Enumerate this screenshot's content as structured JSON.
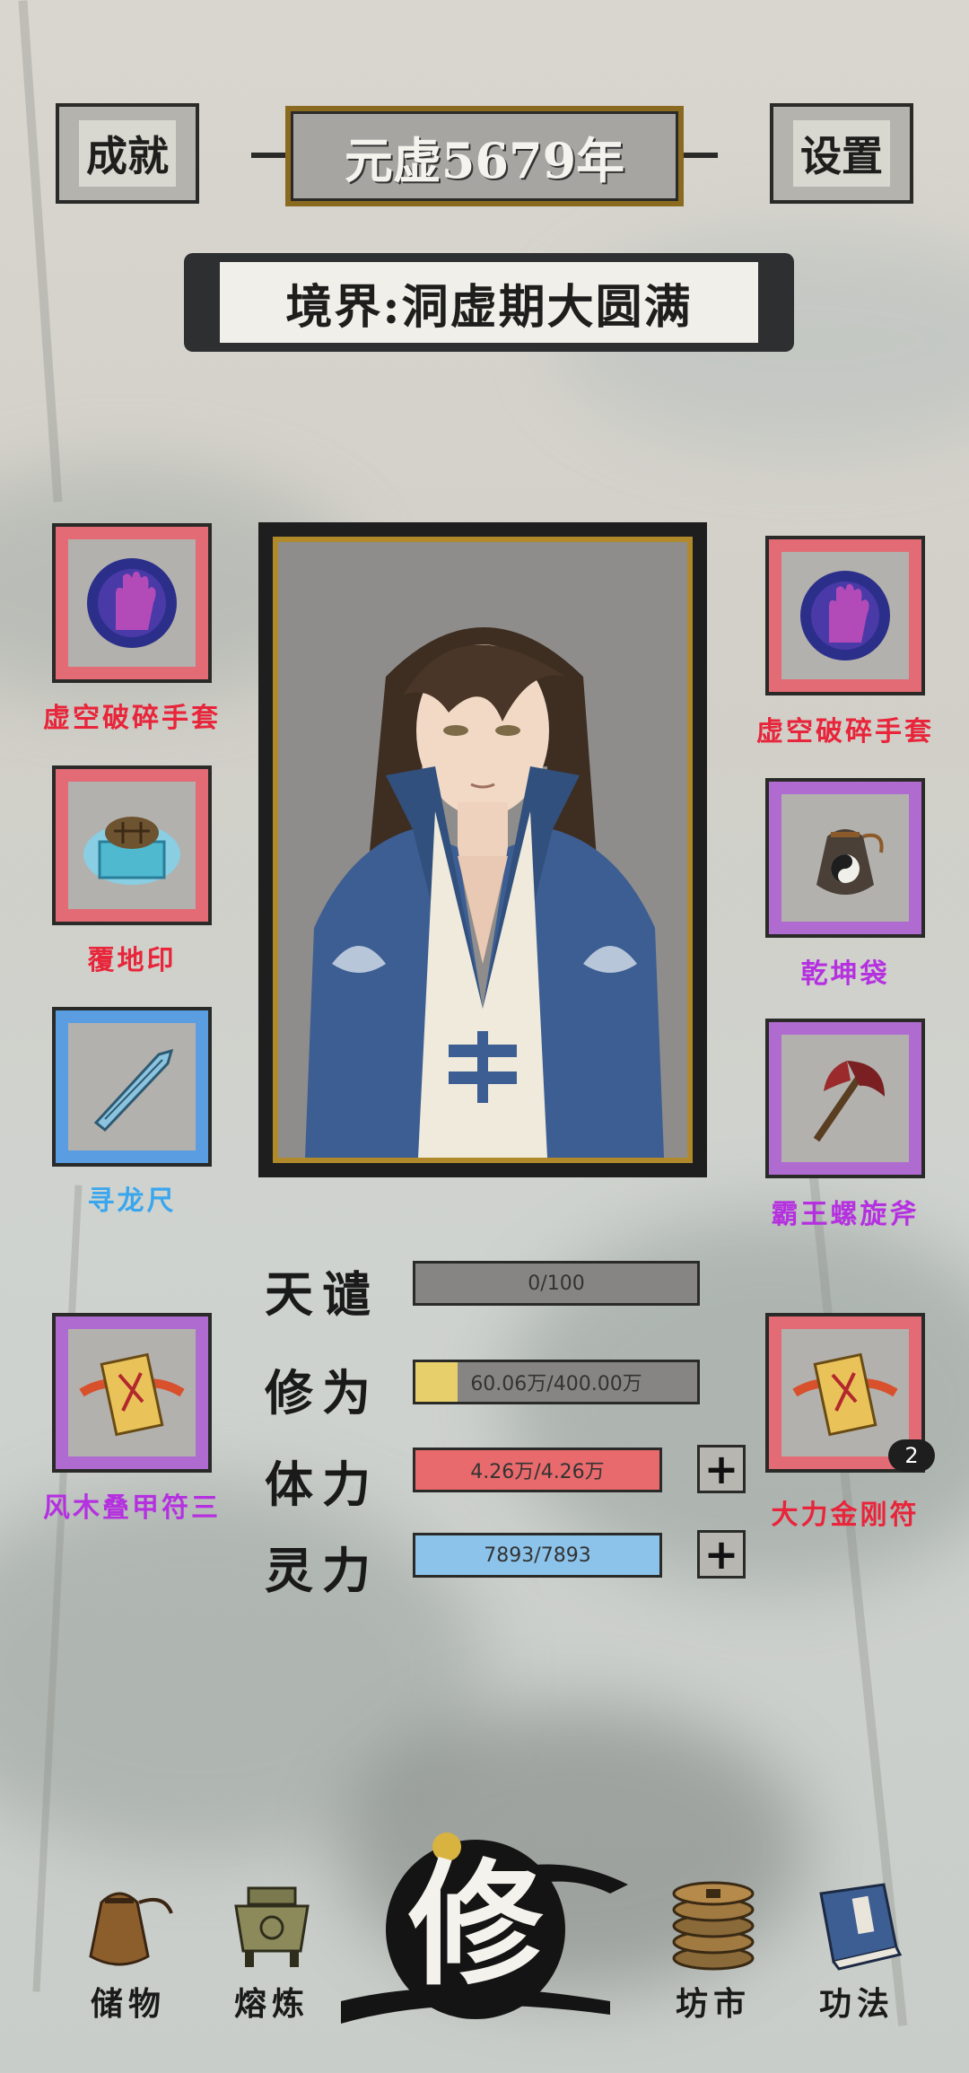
{
  "header": {
    "achievements_label": "成就",
    "year": "元虚5679年",
    "settings_label": "设置",
    "realm": "境界:洞虚期大圆满"
  },
  "equipment_left": [
    {
      "name": "虚空破碎手套",
      "rarity": "red"
    },
    {
      "name": "覆地印",
      "rarity": "red"
    },
    {
      "name": "寻龙尺",
      "rarity": "blue"
    },
    {
      "name": "风木叠甲符三",
      "rarity": "purple"
    }
  ],
  "equipment_right": [
    {
      "name": "虚空破碎手套",
      "rarity": "red"
    },
    {
      "name": "乾坤袋",
      "rarity": "purple"
    },
    {
      "name": "霸王螺旋斧",
      "rarity": "purple"
    },
    {
      "name": "大力金刚符",
      "rarity": "red",
      "count": "2"
    }
  ],
  "stats": {
    "tribulation": {
      "label": "天谴",
      "value": "0/100",
      "fraction": 0.0
    },
    "cultivation": {
      "label": "修为",
      "value": "60.06万/400.00万",
      "fraction": 0.15
    },
    "stamina": {
      "label": "体力",
      "value": "4.26万/4.26万",
      "fraction": 1.0
    },
    "spirit": {
      "label": "灵力",
      "value": "7893/7893",
      "fraction": 1.0
    },
    "plus": "+"
  },
  "nav": {
    "storage": "储物",
    "refine": "熔炼",
    "cultivate": "修",
    "market": "坊市",
    "techniques": "功法"
  },
  "colors": {
    "red": "#e8253a",
    "purple": "#b531e0",
    "blue": "#3aa6ee",
    "cultivation_fill": "#e7cf6b",
    "stamina_fill": "#e86a6c",
    "spirit_fill": "#8cc3ea"
  }
}
